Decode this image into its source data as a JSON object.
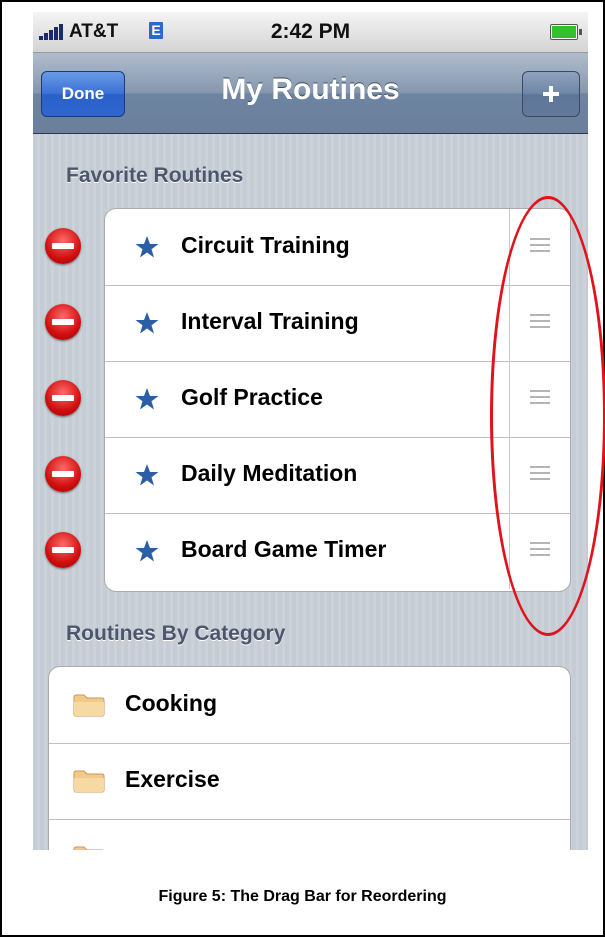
{
  "status_bar": {
    "carrier": "AT&T",
    "network": "E",
    "time": "2:42 PM"
  },
  "nav": {
    "done_label": "Done",
    "title": "My Routines",
    "add_icon": "plus-icon"
  },
  "favorites": {
    "header": "Favorite Routines",
    "items": [
      {
        "label": "Circuit Training"
      },
      {
        "label": "Interval Training"
      },
      {
        "label": "Golf Practice"
      },
      {
        "label": "Daily Meditation"
      },
      {
        "label": "Board Game Timer"
      }
    ]
  },
  "categories": {
    "header": "Routines By Category",
    "items": [
      {
        "label": "Cooking"
      },
      {
        "label": "Exercise"
      }
    ]
  },
  "caption": "Figure 5:  The Drag Bar for Reordering",
  "colors": {
    "nav_bar": "#6d84a2",
    "done_button": "#2f66d0",
    "delete_red": "#d10f0f",
    "star_blue": "#2a5fa8",
    "highlight_ring": "#e0121b"
  }
}
